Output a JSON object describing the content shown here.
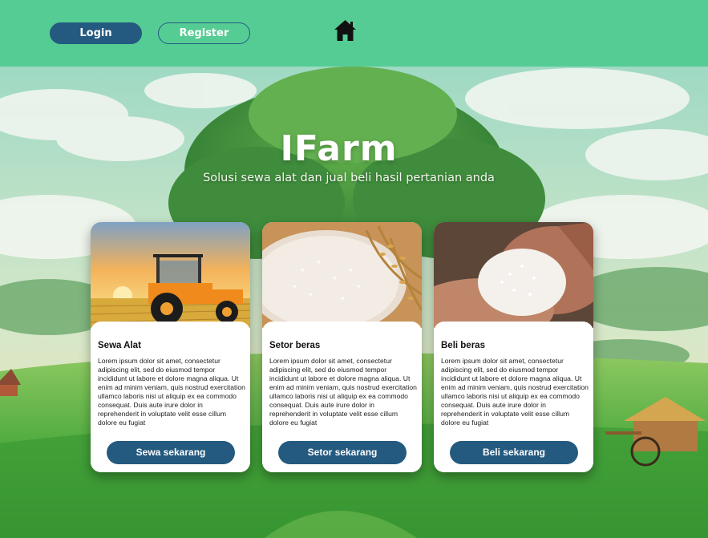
{
  "header": {
    "login_label": "Login",
    "register_label": "Register",
    "home_icon": "home-icon"
  },
  "hero": {
    "title": "IFarm",
    "subtitle": "Solusi sewa alat dan jual beli hasil pertanian anda"
  },
  "cards": [
    {
      "title": "Sewa Alat",
      "image": "tractor-sunset-image",
      "text": "Lorem ipsum dolor sit amet, consectetur adipiscing elit, sed do eiusmod tempor incididunt ut labore et dolore magna aliqua. Ut enim ad minim veniam, quis nostrud exercitation ullamco laboris nisi ut aliquip ex ea commodo consequat. Duis aute irure dolor in reprehenderit in voluptate velit esse cillum dolore eu fugiat",
      "button_label": "Sewa sekarang"
    },
    {
      "title": "Setor beras",
      "image": "rice-grain-basket-image",
      "text": "Lorem ipsum dolor sit amet, consectetur adipiscing elit, sed do eiusmod tempor incididunt ut labore et dolore magna aliqua. Ut enim ad minim veniam, quis nostrud exercitation ullamco laboris nisi ut aliquip ex ea commodo consequat. Duis aute irure dolor in reprehenderit in voluptate velit esse cillum dolore eu fugiat",
      "button_label": "Setor sekarang"
    },
    {
      "title": "Beli beras",
      "image": "rice-in-hands-image",
      "text": "Lorem ipsum dolor sit amet, consectetur adipiscing elit, sed do eiusmod tempor incididunt ut labore et dolore magna aliqua. Ut enim ad minim veniam, quis nostrud exercitation ullamco laboris nisi ut aliquip ex ea commodo consequat. Duis aute irure dolor in reprehenderit in voluptate velit esse cillum dolore eu fugiat",
      "button_label": "Beli sekarang"
    }
  ],
  "colors": {
    "header_bg": "#55cc94",
    "primary_button": "#245a80",
    "card_bg": "#ffffff"
  }
}
